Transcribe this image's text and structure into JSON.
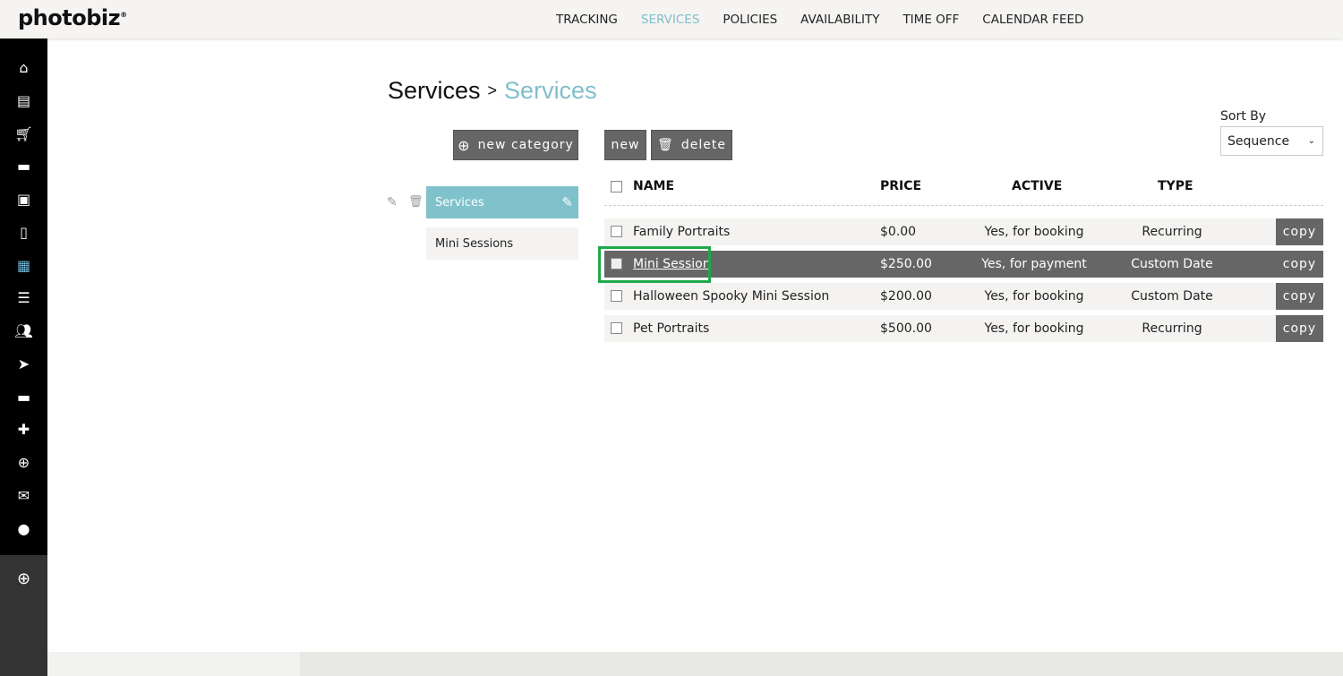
{
  "brand": "photobiz",
  "nav": [
    "TRACKING",
    "SERVICES",
    "POLICIES",
    "AVAILABILITY",
    "TIME OFF",
    "CALENDAR FEED"
  ],
  "nav_active": "SERVICES",
  "sidebar_icons": [
    "home-icon",
    "website-icon",
    "cart-icon",
    "chat-icon",
    "gallery-icon",
    "invoice-icon",
    "calendar-icon",
    "list-icon",
    "contacts-icon",
    "send-icon",
    "folder-icon",
    "puzzle-icon",
    "globe-icon",
    "mail-icon",
    "account-icon",
    "add-icon"
  ],
  "breadcrumb": {
    "parent": "Services",
    "sep": ">",
    "current": "Services"
  },
  "buttons": {
    "new_category": "new category",
    "new": "new",
    "delete": "delete"
  },
  "categories": [
    {
      "label": "Services",
      "selected": true
    },
    {
      "label": "Mini Sessions",
      "selected": false
    }
  ],
  "sort": {
    "label": "Sort By",
    "value": "Sequence"
  },
  "table": {
    "headers": {
      "name": "NAME",
      "price": "PRICE",
      "active": "ACTIVE",
      "type": "TYPE"
    },
    "rows": [
      {
        "name": "Family Portraits",
        "price": "$0.00",
        "active": "Yes, for booking",
        "type": "Recurring",
        "copy": "copy"
      },
      {
        "name": "Mini Session",
        "price": "$250.00",
        "active": "Yes, for payment",
        "type": "Custom Date",
        "copy": "copy"
      },
      {
        "name": "Halloween Spooky Mini Session",
        "price": "$200.00",
        "active": "Yes, for booking",
        "type": "Custom Date",
        "copy": "copy"
      },
      {
        "name": "Pet Portraits",
        "price": "$500.00",
        "active": "Yes, for booking",
        "type": "Recurring",
        "copy": "copy"
      }
    ]
  },
  "colors": {
    "accent": "#7fbfca",
    "highlight": "#1fa84a",
    "button": "#666666"
  }
}
